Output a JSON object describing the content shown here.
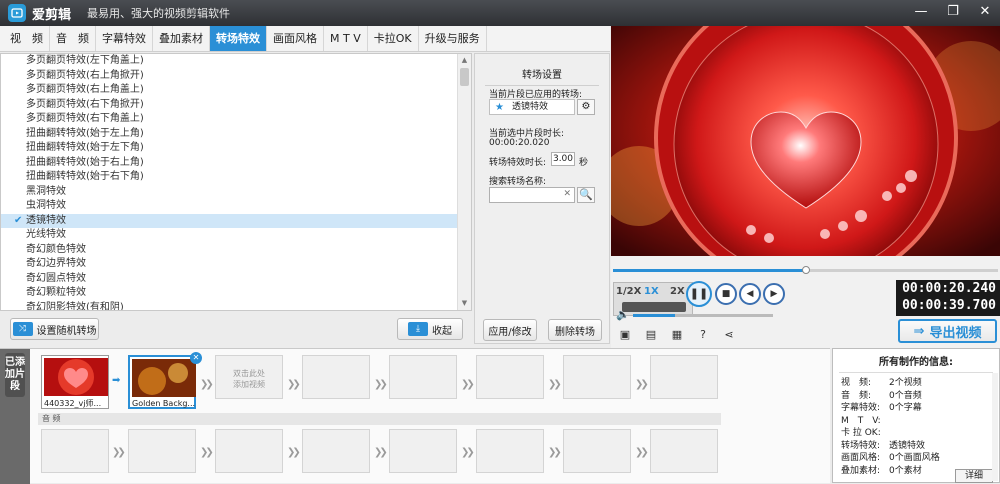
{
  "app": {
    "name": "爱剪辑",
    "slogan": "最易用、强大的视频剪辑软件",
    "window_buttons": {
      "minimize": "—",
      "maximize": "❐",
      "close": "✕"
    }
  },
  "tabs": [
    {
      "label": "视　频"
    },
    {
      "label": "音　频"
    },
    {
      "label": "字幕特效"
    },
    {
      "label": "叠加素材"
    },
    {
      "label": "转场特效",
      "active": true
    },
    {
      "label": "画面风格"
    },
    {
      "label": "M T V"
    },
    {
      "label": "卡拉OK"
    },
    {
      "label": "升级与服务"
    }
  ],
  "transitions": {
    "items": [
      "多页翻页特效(左下角盖上)",
      "多页翻页特效(右上角掀开)",
      "多页翻页特效(右上角盖上)",
      "多页翻页特效(右下角掀开)",
      "多页翻页特效(右下角盖上)",
      "扭曲翻转特效(始于左上角)",
      "扭曲翻转特效(始于左下角)",
      "扭曲翻转特效(始于右上角)",
      "扭曲翻转特效(始于右下角)",
      "黑洞特效",
      "虫洞特效",
      "透镜特效",
      "光线特效",
      "奇幻颜色特效",
      "奇幻边界特效",
      "奇幻圆点特效",
      "奇幻颗粒特效",
      "奇幻阴影特效(有和阴)"
    ],
    "selected_index": 11,
    "random_button": "设置随机转场",
    "collapse_button": "收起"
  },
  "settings": {
    "title": "转场设置",
    "applied_label": "当前片段已应用的转场:",
    "applied_value": "透镜特效",
    "clip_duration_label": "当前选中片段时长:",
    "clip_duration_value": "00:00:20.020",
    "effect_duration_label": "转场特效时长:",
    "effect_duration_value": "3.00",
    "effect_duration_unit": "秒",
    "search_label": "搜索转场名称:",
    "search_value": "",
    "search_clear": "✕",
    "apply_button": "应用/修改",
    "delete_button": "删除转场"
  },
  "player": {
    "progress": 0.5,
    "speeds": [
      "1/2X",
      "1X",
      "2X"
    ],
    "active_speed": "1X",
    "time_current": "00:00:20.240",
    "time_total": "00:00:39.700",
    "export_label": "导出视频",
    "volume": 0.3
  },
  "storyboard": {
    "side_label": "已添加片段",
    "clips": [
      {
        "caption": "440332_vj师..."
      },
      {
        "caption": "Golden Backg..."
      }
    ],
    "add_hint_line1": "双击此处",
    "add_hint_line2": "添加视频",
    "audio_label": "音 频"
  },
  "info": {
    "title": "所有制作的信息:",
    "rows": [
      {
        "k": "视　频:",
        "v": "2个视频"
      },
      {
        "k": "音　频:",
        "v": "0个音频"
      },
      {
        "k": "字幕特效:",
        "v": "0个字幕"
      },
      {
        "k": "M　T　V:",
        "v": ""
      },
      {
        "k": "卡 拉 OK:",
        "v": ""
      },
      {
        "k": "转场特效:",
        "v": "透镜特效"
      },
      {
        "k": "画面风格:",
        "v": "0个画面风格"
      },
      {
        "k": "叠加素材:",
        "v": "0个素材"
      }
    ],
    "detail_button": "详细"
  },
  "colors": {
    "accent": "#2a8fd6",
    "titlebar": "#3a3d42"
  }
}
